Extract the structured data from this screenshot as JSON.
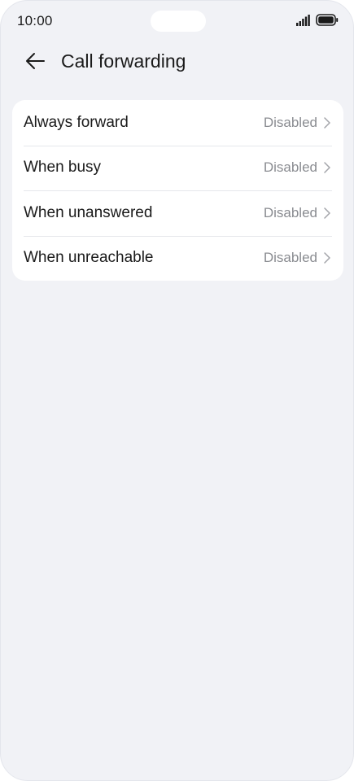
{
  "status_bar": {
    "time": "10:00"
  },
  "header": {
    "title": "Call forwarding"
  },
  "settings": {
    "items": [
      {
        "label": "Always forward",
        "value": "Disabled"
      },
      {
        "label": "When busy",
        "value": "Disabled"
      },
      {
        "label": "When unanswered",
        "value": "Disabled"
      },
      {
        "label": "When unreachable",
        "value": "Disabled"
      }
    ]
  },
  "colors": {
    "background": "#f1f2f6",
    "card": "#ffffff",
    "primary_text": "#1a1a1a",
    "secondary_text": "#8a8c91",
    "divider": "#e6e7eb"
  },
  "icons": {
    "back": "arrow-left-icon",
    "chevron": "chevron-right-icon",
    "signal": "signal-icon",
    "battery": "battery-icon"
  }
}
